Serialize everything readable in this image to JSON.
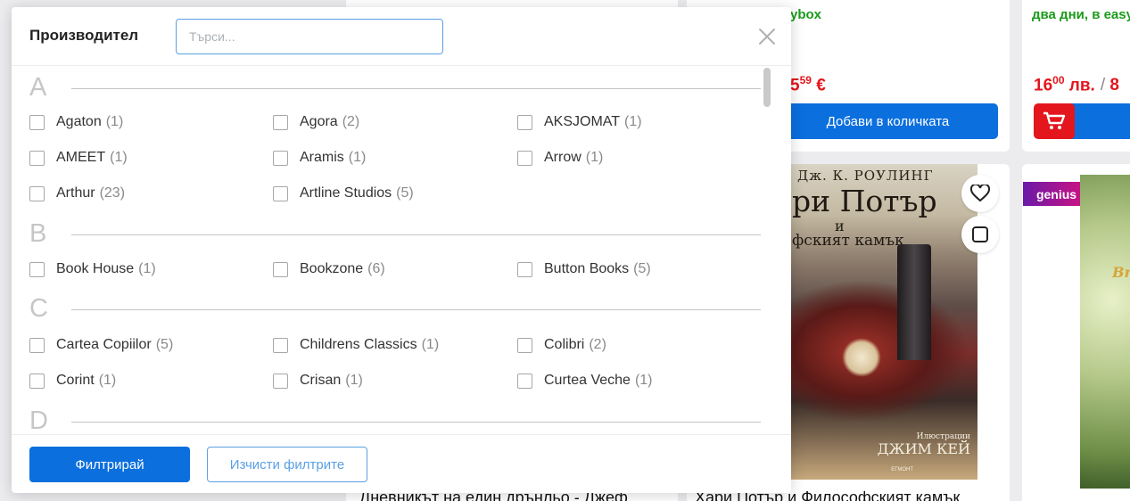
{
  "background": {
    "card1": {
      "partial_text": "",
      "price_whole": "",
      "price_cents": "",
      "add_to_cart": "Добави в количката",
      "price_tail": "5",
      "price_tail_cents": "59",
      "currency": "€"
    },
    "card2": {
      "partial_text": "ybox"
    },
    "card3": {
      "partial_text": "два дни, в easy",
      "price_whole": "16",
      "price_cents": "00",
      "currency": "лв.",
      "slash": "/",
      "old_fragment": "8"
    },
    "card4": {
      "title": "Дневникът на един дрънльо - Джеф"
    },
    "card5": {
      "title": "Хари Потър и Философският камък",
      "cover": {
        "author": "Дж. К. РОУЛИНГ",
        "title_main": "ри Потър",
        "title_and": "и",
        "title_sub": "фският камък",
        "illustrator_label": "Илюстрации",
        "illustrator": "ДЖИМ КЕЙ",
        "publisher": "ЕГМОНТ"
      },
      "wishlist_icon": "heart-icon",
      "compare_icon": "compare-icon"
    },
    "card6": {
      "badge": "genius",
      "cover_text": "Br"
    }
  },
  "modal": {
    "title": "Производител",
    "search": {
      "placeholder": "Търси...",
      "value": ""
    },
    "close_icon": "close-icon",
    "groups": [
      {
        "letter": "A",
        "items": [
          {
            "name": "Agaton",
            "count": "(1)"
          },
          {
            "name": "Agora",
            "count": "(2)"
          },
          {
            "name": "AKSJOMAT",
            "count": "(1)"
          },
          {
            "name": "AMEET",
            "count": "(1)"
          },
          {
            "name": "Aramis",
            "count": "(1)"
          },
          {
            "name": "Arrow",
            "count": "(1)"
          },
          {
            "name": "Arthur",
            "count": "(23)"
          },
          {
            "name": "Artline Studios",
            "count": "(5)"
          }
        ]
      },
      {
        "letter": "B",
        "items": [
          {
            "name": "Book House",
            "count": "(1)"
          },
          {
            "name": "Bookzone",
            "count": "(6)"
          },
          {
            "name": "Button Books",
            "count": "(5)"
          }
        ]
      },
      {
        "letter": "C",
        "items": [
          {
            "name": "Cartea Copiilor",
            "count": "(5)"
          },
          {
            "name": "Childrens Classics",
            "count": "(1)"
          },
          {
            "name": "Colibri",
            "count": "(2)"
          },
          {
            "name": "Corint",
            "count": "(1)"
          },
          {
            "name": "Crisan",
            "count": "(1)"
          },
          {
            "name": "Curtea Veche",
            "count": "(1)"
          }
        ]
      },
      {
        "letter": "D",
        "items": []
      }
    ],
    "footer": {
      "filter_label": "Филтрирай",
      "clear_label": "Изчисти филтрите"
    }
  },
  "colors": {
    "primary": "#0b6fde",
    "accent_red": "#e3161d",
    "green": "#1a9b1a",
    "outline_blue": "#5aa0e4"
  }
}
